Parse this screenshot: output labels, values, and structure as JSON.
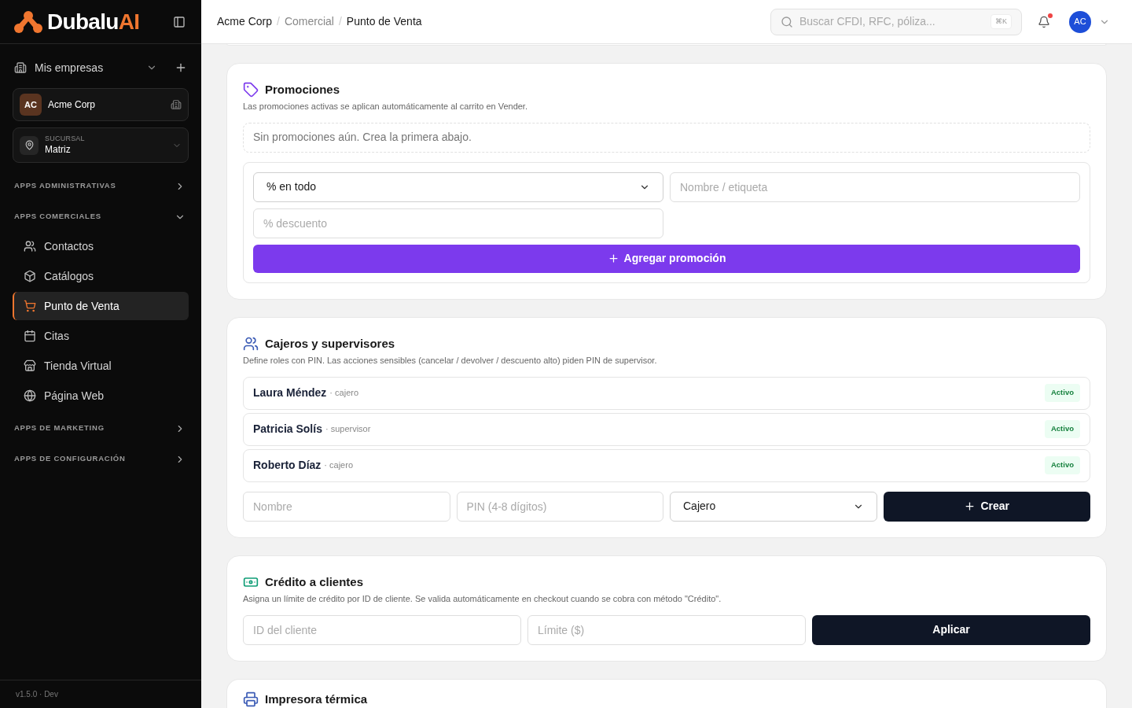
{
  "sidebar": {
    "logo": {
      "brand": "Dubalu",
      "accent": "AI"
    },
    "companies_label": "Mis empresas",
    "company": {
      "initials": "AC",
      "name": "Acme Corp"
    },
    "branch": {
      "label": "SUCURSAL",
      "value": "Matriz"
    },
    "groups": [
      {
        "label": "APPS ADMINISTRATIVAS",
        "expanded": false
      },
      {
        "label": "APPS COMERCIALES",
        "expanded": true,
        "items": [
          {
            "label": "Contactos",
            "selected": false
          },
          {
            "label": "Catálogos",
            "selected": false
          },
          {
            "label": "Punto de Venta",
            "selected": true
          },
          {
            "label": "Citas",
            "selected": false
          },
          {
            "label": "Tienda Virtual",
            "selected": false
          },
          {
            "label": "Página Web",
            "selected": false
          }
        ]
      },
      {
        "label": "APPS DE MARKETING",
        "expanded": false
      },
      {
        "label": "APPS DE CONFIGURACIÓN",
        "expanded": false
      }
    ],
    "version": "v1.5.0 · Dev"
  },
  "header": {
    "breadcrumb": [
      {
        "kind": "crumb",
        "label": "Acme Corp",
        "muted": false
      },
      {
        "kind": "separator",
        "label": "/"
      },
      {
        "kind": "crumb",
        "label": "Comercial",
        "muted": true
      },
      {
        "kind": "separator",
        "label": "/"
      },
      {
        "kind": "crumb",
        "label": "Punto de Venta",
        "muted": false
      }
    ],
    "search": {
      "placeholder": "Buscar CFDI, RFC, póliza...",
      "shortcut": "⌘K"
    },
    "notifications": {
      "unread": true
    },
    "avatar": "AC"
  },
  "promotions": {
    "title": "Promociones",
    "description": "Las promociones activas se aplican automáticamente al carrito en Vender.",
    "empty": "Sin promociones aún. Crea la primera abajo.",
    "type_select": "% en todo",
    "name_placeholder": "Nombre / etiqueta",
    "discount_placeholder": "% descuento",
    "add_button": "Agregar promoción"
  },
  "cashiers": {
    "title": "Cajeros y supervisores",
    "description": "Define roles con PIN. Las acciones sensibles (cancelar / devolver / descuento alto) piden PIN de supervisor.",
    "rows": [
      {
        "name": "Laura Méndez",
        "role": "· cajero",
        "status": "Activo"
      },
      {
        "name": "Patricia Solís",
        "role": "· supervisor",
        "status": "Activo"
      },
      {
        "name": "Roberto Díaz",
        "role": "· cajero",
        "status": "Activo"
      }
    ],
    "name_placeholder": "Nombre",
    "pin_placeholder": "PIN (4-8 dígitos)",
    "role_select": "Cajero",
    "create_button": "Crear"
  },
  "credit": {
    "title": "Crédito a clientes",
    "description": "Asigna un límite de crédito por ID de cliente. Se valida automáticamente en checkout cuando se cobra con método \"Crédito\".",
    "id_placeholder": "ID del cliente",
    "limit_placeholder": "Límite ($)",
    "apply_button": "Aplicar"
  },
  "printer": {
    "title": "Impresora térmica"
  }
}
